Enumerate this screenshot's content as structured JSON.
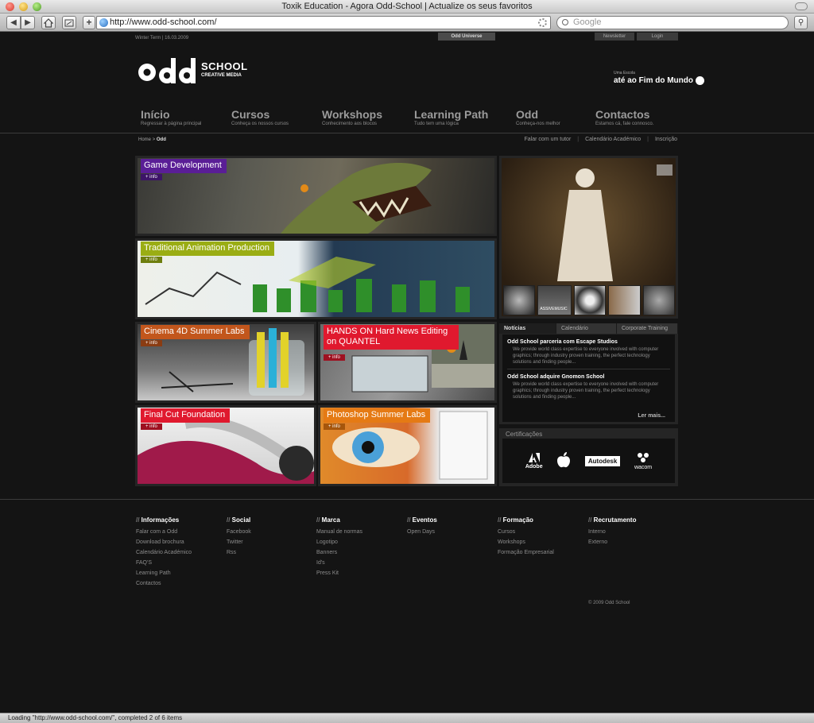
{
  "browser": {
    "window_title": "Toxik Education - Agora Odd-School | Actualize os seus favoritos",
    "url": "http://www.odd-school.com/",
    "search_placeholder": "Google",
    "status": "Loading \"http://www.odd-school.com/\", completed 2 of 6 items"
  },
  "header": {
    "term": "Winter Term | 16.03.2009",
    "odd_universe": "Odd Universe",
    "newsletter": "Newsletter",
    "login": "Login",
    "logo_word": "Odd",
    "logo_school": "SCHOOL",
    "logo_sub": "CREATIVE MEDIA",
    "escola_top": "Uma Escola",
    "escola_name": "até ao Fim do Mundo"
  },
  "nav": [
    {
      "label": "Início",
      "sub": "Regressar à página principal"
    },
    {
      "label": "Cursos",
      "sub": "Conheça os nossos cursos"
    },
    {
      "label": "Workshops",
      "sub": "Conhecimento aos blocos"
    },
    {
      "label": "Learning Path",
      "sub": "Tudo tem uma lógica"
    },
    {
      "label": "Odd",
      "sub": "Conheça-nos melhor"
    },
    {
      "label": "Contactos",
      "sub": "Estamos cá, fale connosco."
    }
  ],
  "breadcrumb": {
    "home": "Home",
    "sep": ">",
    "current": "Odd"
  },
  "toplinks": [
    "Falar com um tutor",
    "Calendário Académico",
    "Inscrição"
  ],
  "tiles": [
    {
      "label": "Game Development",
      "info": "+ info",
      "color": "#5a1e96"
    },
    {
      "label": "Traditional Animation Production",
      "info": "+ info",
      "color": "#9aad14"
    },
    {
      "label": "Cinema 4D Summer Labs",
      "info": "+ info",
      "color": "#c2561c"
    },
    {
      "label": "HANDS ON Hard News Editing on QUANTEL",
      "info": "+ info",
      "color": "#e0192e"
    },
    {
      "label": "Final Cut Foundation",
      "info": "+ info",
      "color": "#e0192e"
    },
    {
      "label": "Photoshop Summer Labs",
      "info": "+ info",
      "color": "#e57a14"
    }
  ],
  "thumb_texts": [
    "ASSIVEMUSIC"
  ],
  "news": {
    "tabs": [
      "Notícias",
      "Calendário",
      "Corporate Training"
    ],
    "items": [
      {
        "title": "Odd School parceria com Escape Studios",
        "text": "We provide world class expertise to everyone involved with computer graphics; through industry proven training, the perfect technology solutions and finding people..."
      },
      {
        "title": "Odd School adquire Gnomon School",
        "text": "We provide world class expertise to everyone involved with computer graphics; through industry proven training, the perfect technology solutions and finding people..."
      }
    ],
    "more": "Ler mais..."
  },
  "cert": {
    "title": "Certificações",
    "logos": [
      "Adobe",
      "",
      "Autodesk",
      "wacom"
    ]
  },
  "footer": {
    "columns": [
      {
        "title": "Informações",
        "links": [
          "Falar com a Odd",
          "Download brochura",
          "Calendário Académico",
          "FAQ'S",
          "Learning Path",
          "Contactos"
        ]
      },
      {
        "title": "Social",
        "links": [
          "Facebook",
          "Twitter",
          "Rss"
        ]
      },
      {
        "title": "Marca",
        "links": [
          "Manual de normas",
          "Logotipo",
          "Banners",
          "Id's",
          "Press Kit"
        ]
      },
      {
        "title": "Eventos",
        "links": [
          "Open Days"
        ]
      },
      {
        "title": "Formação",
        "links": [
          "Cursos",
          "Workshops",
          "Formação Empresarial"
        ]
      },
      {
        "title": "Recrutamento",
        "links": [
          "Interno",
          "Externo"
        ]
      }
    ],
    "copyright": "© 2009 Odd School"
  }
}
